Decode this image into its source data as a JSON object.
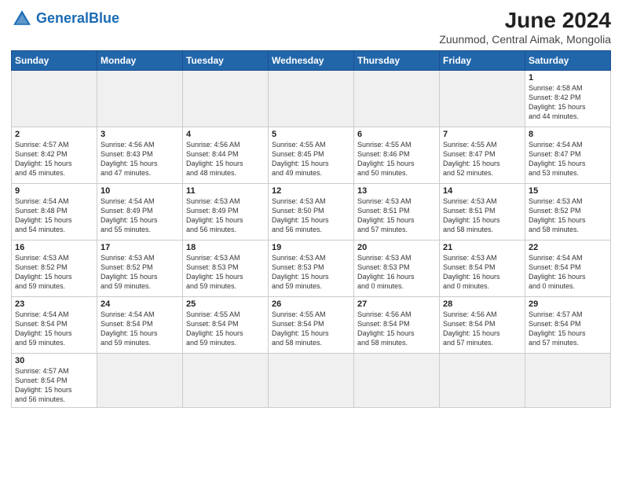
{
  "header": {
    "logo_general": "General",
    "logo_blue": "Blue",
    "main_title": "June 2024",
    "subtitle": "Zuunmod, Central Aimak, Mongolia"
  },
  "weekdays": [
    "Sunday",
    "Monday",
    "Tuesday",
    "Wednesday",
    "Thursday",
    "Friday",
    "Saturday"
  ],
  "weeks": [
    [
      {
        "day": "",
        "info": "",
        "empty": true
      },
      {
        "day": "",
        "info": "",
        "empty": true
      },
      {
        "day": "",
        "info": "",
        "empty": true
      },
      {
        "day": "",
        "info": "",
        "empty": true
      },
      {
        "day": "",
        "info": "",
        "empty": true
      },
      {
        "day": "",
        "info": "",
        "empty": true
      },
      {
        "day": "1",
        "info": "Sunrise: 4:58 AM\nSunset: 8:42 PM\nDaylight: 15 hours\nand 44 minutes."
      }
    ],
    [
      {
        "day": "2",
        "info": "Sunrise: 4:57 AM\nSunset: 8:42 PM\nDaylight: 15 hours\nand 45 minutes."
      },
      {
        "day": "3",
        "info": "Sunrise: 4:56 AM\nSunset: 8:43 PM\nDaylight: 15 hours\nand 47 minutes."
      },
      {
        "day": "4",
        "info": "Sunrise: 4:56 AM\nSunset: 8:44 PM\nDaylight: 15 hours\nand 48 minutes."
      },
      {
        "day": "5",
        "info": "Sunrise: 4:55 AM\nSunset: 8:45 PM\nDaylight: 15 hours\nand 49 minutes."
      },
      {
        "day": "6",
        "info": "Sunrise: 4:55 AM\nSunset: 8:46 PM\nDaylight: 15 hours\nand 50 minutes."
      },
      {
        "day": "7",
        "info": "Sunrise: 4:55 AM\nSunset: 8:47 PM\nDaylight: 15 hours\nand 52 minutes."
      },
      {
        "day": "8",
        "info": "Sunrise: 4:54 AM\nSunset: 8:47 PM\nDaylight: 15 hours\nand 53 minutes."
      }
    ],
    [
      {
        "day": "9",
        "info": "Sunrise: 4:54 AM\nSunset: 8:48 PM\nDaylight: 15 hours\nand 54 minutes."
      },
      {
        "day": "10",
        "info": "Sunrise: 4:54 AM\nSunset: 8:49 PM\nDaylight: 15 hours\nand 55 minutes."
      },
      {
        "day": "11",
        "info": "Sunrise: 4:53 AM\nSunset: 8:49 PM\nDaylight: 15 hours\nand 56 minutes."
      },
      {
        "day": "12",
        "info": "Sunrise: 4:53 AM\nSunset: 8:50 PM\nDaylight: 15 hours\nand 56 minutes."
      },
      {
        "day": "13",
        "info": "Sunrise: 4:53 AM\nSunset: 8:51 PM\nDaylight: 15 hours\nand 57 minutes."
      },
      {
        "day": "14",
        "info": "Sunrise: 4:53 AM\nSunset: 8:51 PM\nDaylight: 15 hours\nand 58 minutes."
      },
      {
        "day": "15",
        "info": "Sunrise: 4:53 AM\nSunset: 8:52 PM\nDaylight: 15 hours\nand 58 minutes."
      }
    ],
    [
      {
        "day": "16",
        "info": "Sunrise: 4:53 AM\nSunset: 8:52 PM\nDaylight: 15 hours\nand 59 minutes."
      },
      {
        "day": "17",
        "info": "Sunrise: 4:53 AM\nSunset: 8:52 PM\nDaylight: 15 hours\nand 59 minutes."
      },
      {
        "day": "18",
        "info": "Sunrise: 4:53 AM\nSunset: 8:53 PM\nDaylight: 15 hours\nand 59 minutes."
      },
      {
        "day": "19",
        "info": "Sunrise: 4:53 AM\nSunset: 8:53 PM\nDaylight: 15 hours\nand 59 minutes."
      },
      {
        "day": "20",
        "info": "Sunrise: 4:53 AM\nSunset: 8:53 PM\nDaylight: 16 hours\nand 0 minutes."
      },
      {
        "day": "21",
        "info": "Sunrise: 4:53 AM\nSunset: 8:54 PM\nDaylight: 16 hours\nand 0 minutes."
      },
      {
        "day": "22",
        "info": "Sunrise: 4:54 AM\nSunset: 8:54 PM\nDaylight: 16 hours\nand 0 minutes."
      }
    ],
    [
      {
        "day": "23",
        "info": "Sunrise: 4:54 AM\nSunset: 8:54 PM\nDaylight: 15 hours\nand 59 minutes."
      },
      {
        "day": "24",
        "info": "Sunrise: 4:54 AM\nSunset: 8:54 PM\nDaylight: 15 hours\nand 59 minutes."
      },
      {
        "day": "25",
        "info": "Sunrise: 4:55 AM\nSunset: 8:54 PM\nDaylight: 15 hours\nand 59 minutes."
      },
      {
        "day": "26",
        "info": "Sunrise: 4:55 AM\nSunset: 8:54 PM\nDaylight: 15 hours\nand 58 minutes."
      },
      {
        "day": "27",
        "info": "Sunrise: 4:56 AM\nSunset: 8:54 PM\nDaylight: 15 hours\nand 58 minutes."
      },
      {
        "day": "28",
        "info": "Sunrise: 4:56 AM\nSunset: 8:54 PM\nDaylight: 15 hours\nand 57 minutes."
      },
      {
        "day": "29",
        "info": "Sunrise: 4:57 AM\nSunset: 8:54 PM\nDaylight: 15 hours\nand 57 minutes."
      }
    ],
    [
      {
        "day": "30",
        "info": "Sunrise: 4:57 AM\nSunset: 8:54 PM\nDaylight: 15 hours\nand 56 minutes.",
        "last": true
      },
      {
        "day": "",
        "info": "",
        "empty": true,
        "last": true
      },
      {
        "day": "",
        "info": "",
        "empty": true,
        "last": true
      },
      {
        "day": "",
        "info": "",
        "empty": true,
        "last": true
      },
      {
        "day": "",
        "info": "",
        "empty": true,
        "last": true
      },
      {
        "day": "",
        "info": "",
        "empty": true,
        "last": true
      },
      {
        "day": "",
        "info": "",
        "empty": true,
        "last": true
      }
    ]
  ]
}
